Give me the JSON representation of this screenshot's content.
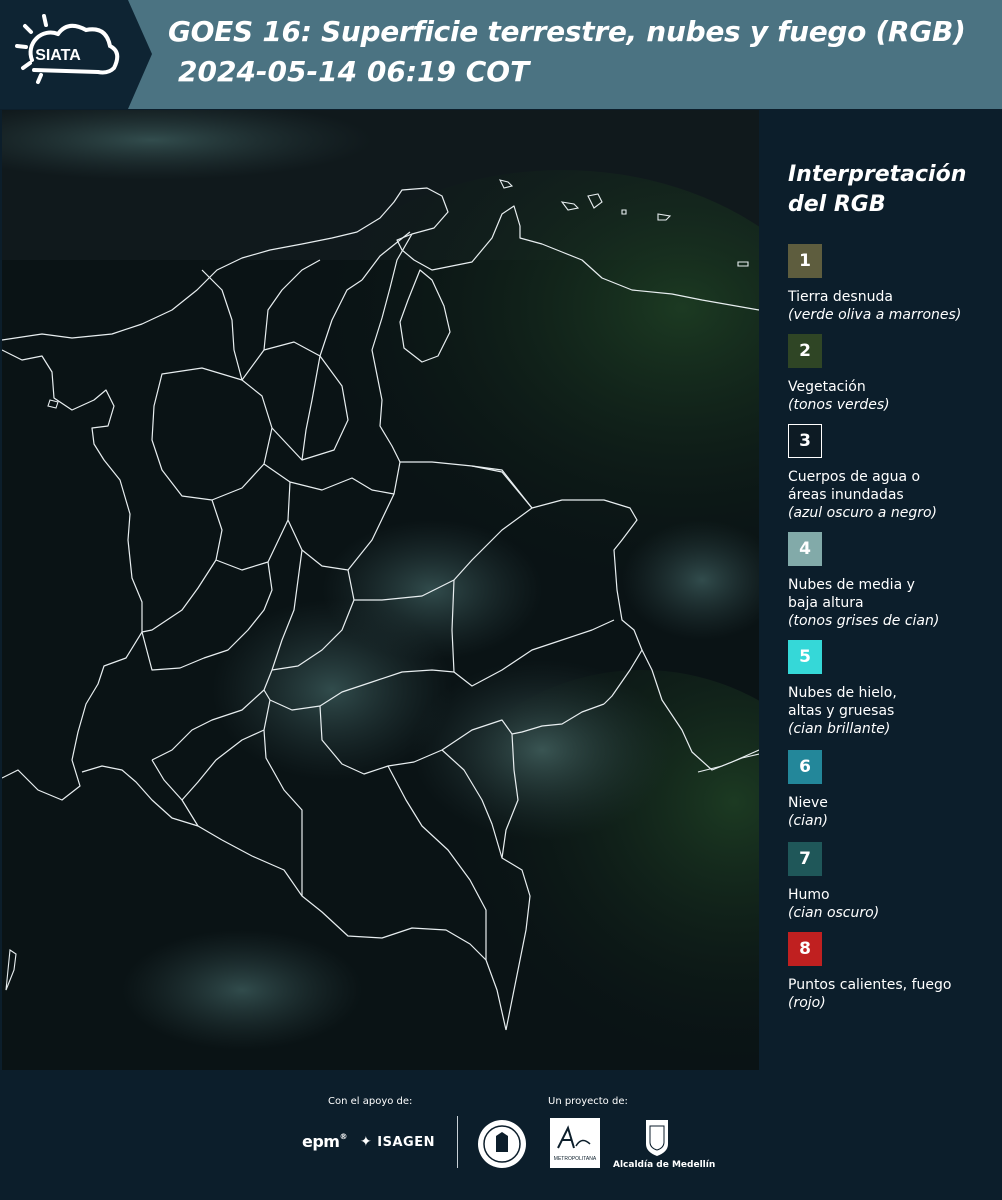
{
  "header": {
    "logo_text": "SIATA",
    "title": "GOES 16: Superficie terrestre, nubes y fuego (RGB)",
    "datetime": "2024-05-14 06:19 COT"
  },
  "legend": {
    "title": "Interpretación del RGB",
    "items": [
      {
        "num": "1",
        "label": "Tierra desnuda",
        "sub": "(verde oliva a marrones)",
        "color": "#5e5d3e"
      },
      {
        "num": "2",
        "label": "Vegetación",
        "sub": "(tonos verdes)",
        "color": "#2f4525"
      },
      {
        "num": "3",
        "label": "Cuerpos de agua o áreas inundadas",
        "sub": "(azul oscuro a negro)",
        "color": "#0d1b24"
      },
      {
        "num": "4",
        "label": "Nubes de media y baja altura",
        "sub": "(tonos grises de cian)",
        "color": "#82aaa9"
      },
      {
        "num": "5",
        "label": "Nubes de hielo, altas y gruesas",
        "sub": "(cian brillante)",
        "color": "#35d8d8"
      },
      {
        "num": "6",
        "label": "Nieve",
        "sub": "(cian)",
        "color": "#23879a"
      },
      {
        "num": "7",
        "label": "Humo",
        "sub": "(cian oscuro)",
        "color": "#1f5759"
      },
      {
        "num": "8",
        "label": "Puntos calientes, fuego",
        "sub": "(rojo)",
        "color": "#c02020"
      }
    ]
  },
  "footer": {
    "support_label": "Con el apoyo de:",
    "project_label": "Un proyecto de:",
    "epm": "epm",
    "isagen": "ISAGEN",
    "area_text": "METROPOLITANA",
    "alcaldia": "Alcaldía de Medellín"
  },
  "colors": {
    "header_dark": "#0e2433",
    "header_band": "#4b7382",
    "background": "#0c1e2b"
  }
}
